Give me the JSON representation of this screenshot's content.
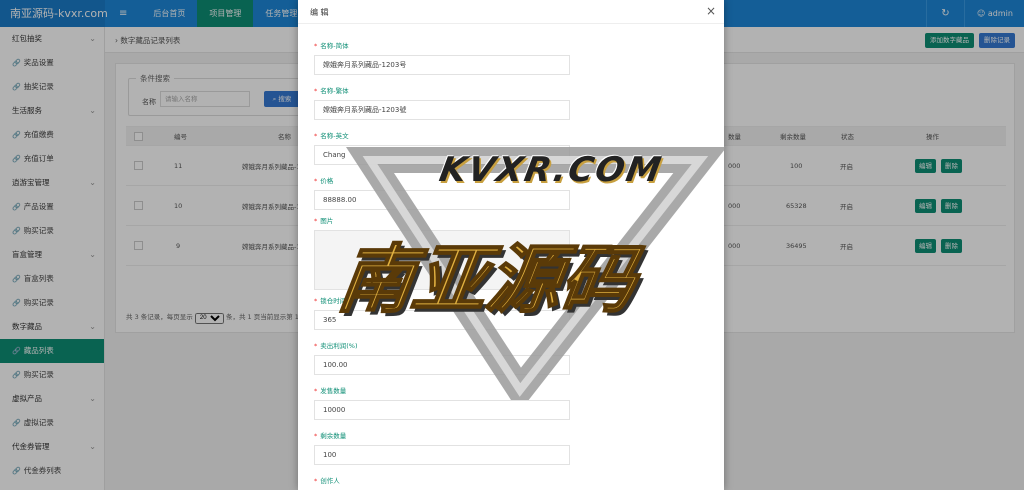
{
  "topbar": {
    "brand": "南亚源码-kvxr.com",
    "menu_icon": "≡",
    "nav": [
      "后台首页",
      "项目管理",
      "任务管理"
    ],
    "active_nav": "项目管理",
    "refresh_icon": "↻",
    "user": "admin"
  },
  "sidebar": {
    "items": [
      {
        "label": "红包抽奖",
        "type": "group"
      },
      {
        "label": "奖品设置",
        "type": "sub"
      },
      {
        "label": "抽奖记录",
        "type": "sub"
      },
      {
        "label": "生活服务",
        "type": "group"
      },
      {
        "label": "充值缴费",
        "type": "sub"
      },
      {
        "label": "充值订单",
        "type": "sub"
      },
      {
        "label": "逍游宝管理",
        "type": "group"
      },
      {
        "label": "产品设置",
        "type": "sub"
      },
      {
        "label": "购买记录",
        "type": "sub"
      },
      {
        "label": "盲盒管理",
        "type": "group"
      },
      {
        "label": "盲盒列表",
        "type": "sub"
      },
      {
        "label": "购买记录",
        "type": "sub"
      },
      {
        "label": "数字藏品",
        "type": "group"
      },
      {
        "label": "藏品列表",
        "type": "sub",
        "active": true
      },
      {
        "label": "购买记录",
        "type": "sub"
      },
      {
        "label": "虚拟产品",
        "type": "group"
      },
      {
        "label": "虚拟记录",
        "type": "sub"
      },
      {
        "label": "代金券管理",
        "type": "group"
      },
      {
        "label": "代金券列表",
        "type": "sub"
      }
    ]
  },
  "content": {
    "breadcrumb": "数字藏品记录列表",
    "add_button": "添加数字藏品",
    "delete_button": "删除记录",
    "search_legend": "条件搜索",
    "search_label": "名称",
    "search_placeholder": "请输入名称",
    "search_button": "搜索",
    "columns": [
      "编号",
      "名称",
      "数量",
      "剩余数量",
      "状态",
      "操作"
    ],
    "rows": [
      {
        "id": "11",
        "name": "嫦娥奔月系列藏品-1",
        "qty": "000",
        "remain": "100",
        "status": "开启"
      },
      {
        "id": "10",
        "name": "嫦娥奔月系列藏品-1",
        "qty": "000",
        "remain": "65328",
        "status": "开启"
      },
      {
        "id": "9",
        "name": "嫦娥奔月系列藏品-1",
        "qty": "000",
        "remain": "36495",
        "status": "开启"
      }
    ],
    "edit_label": "编辑",
    "del_label": "删除",
    "pager_pre": "共 3 条记录，每页显示",
    "pager_size": "20",
    "pager_post": "条，共 1 页当前显示第 1 页"
  },
  "modal": {
    "title": "编 辑",
    "fields": [
      {
        "label": "名称-简体",
        "value": "嫦娥奔月系列藏品-1203号"
      },
      {
        "label": "名称-繁体",
        "value": "嫦娥奔月系列藏品-1203號"
      },
      {
        "label": "名称-英文",
        "value": "Chang"
      },
      {
        "label": "价格",
        "value": "88888.00"
      },
      {
        "label": "图片",
        "value": ""
      },
      {
        "label": "锁仓时间",
        "value": "365"
      },
      {
        "label": "卖出利润(%)",
        "value": "100.00"
      },
      {
        "label": "发售数量",
        "value": "10000"
      },
      {
        "label": "剩余数量",
        "value": "100"
      },
      {
        "label": "创作人",
        "value": ""
      }
    ]
  },
  "watermark": {
    "top": "KVXR.COM",
    "main": "南亚源码"
  }
}
